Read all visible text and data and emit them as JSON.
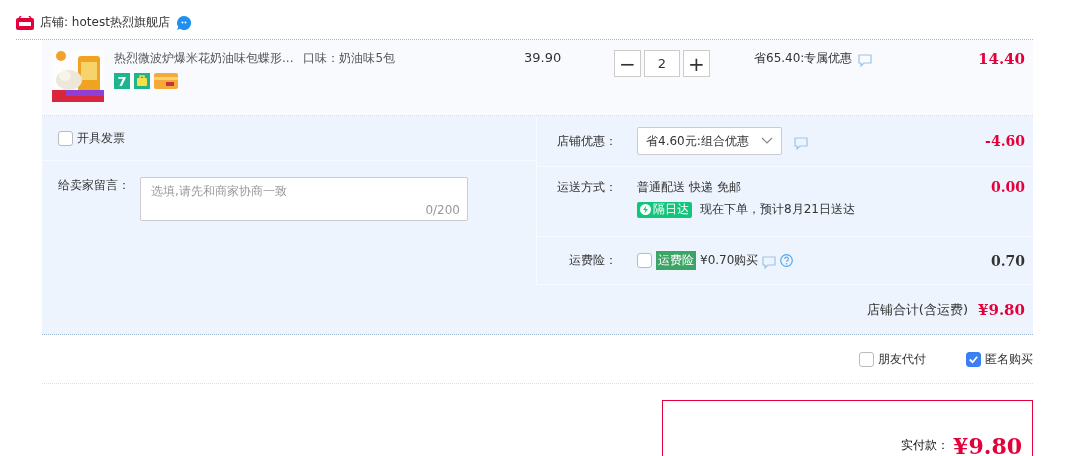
{
  "store": {
    "name": "店铺: hotest热烈旗舰店"
  },
  "item": {
    "title": "热烈微波炉爆米花奶油味包蝶形...",
    "spec": "口味：奶油味5包",
    "price": "39.90",
    "minus": "−",
    "quantity": "2",
    "plus": "+",
    "badge_number": "7",
    "discount": "省65.40:专属优惠",
    "subtotal": "14.40"
  },
  "invoice": {
    "label": "开具发票",
    "checked": false
  },
  "message": {
    "label": "给卖家留言：",
    "placeholder": "选填,请先和商家协商一致",
    "counter": "0/200"
  },
  "store_discount": {
    "label": "店铺优惠：",
    "value": "省4.60元:组合优惠",
    "amount": {
      "text": "-4.60",
      "emphasis": true
    }
  },
  "shipping": {
    "label": "运送方式：",
    "method": "普通配送 快递 免邮",
    "badge": "隔日达",
    "note": "现在下单，预计8月21日送达",
    "amount": {
      "text": "0.00",
      "emphasis": true
    }
  },
  "insurance": {
    "label": "运费险：",
    "checked": false,
    "tag": "运费险",
    "price": "¥0.70购买",
    "amount": {
      "text": "0.70",
      "emphasis": false
    }
  },
  "store_total": {
    "label": "店铺合计(含运费)",
    "amount": "¥9.80"
  },
  "options": [
    {
      "label": "朋友代付",
      "checked": false
    },
    {
      "label": "匿名购买",
      "checked": true
    }
  ],
  "payment": {
    "label": "实付款：",
    "amount": "¥9.80"
  }
}
